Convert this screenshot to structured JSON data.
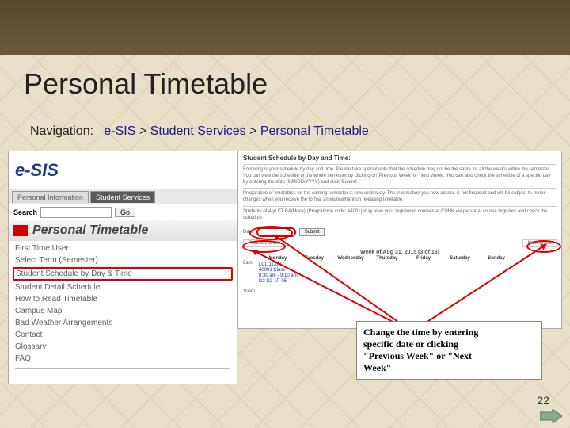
{
  "title": "Personal Timetable",
  "nav": {
    "label": "Navigation:",
    "p1": "e-SIS",
    "sep1": " > ",
    "p2": "Student Services",
    "sep2": " > ",
    "p3": "Personal Timetable"
  },
  "logo": "e-SIS",
  "tabs": {
    "t1": "Personal Information",
    "t2": "Student Services"
  },
  "search": {
    "label": "Search",
    "placeholder": "",
    "go": "Go"
  },
  "ptheader": "Personal Timetable",
  "menu": [
    "First Time User",
    "Select Term (Semester)",
    "Student Schedule by Day & Time",
    "Student Detail Schedule",
    "How to Read Timetable",
    "Campus Map",
    "Bad Weather Arrangements",
    "Contact",
    "Glossary",
    "FAQ"
  ],
  "right": {
    "title": "Student Schedule by Day and Time:",
    "note1": "Following is your schedule by day and time. Please take special note that the schedule may not be the same for all the weeks within the semester. You can view the schedule of the whole semester by clicking on 'Previous Week' or 'Next Week'. You can also check the schedule of a specific day by entering the date (MM/DD/YYYY) and click 'Submit'.",
    "note2": "Preparation of timetables for the coming semester is now underway. The information you now access is not finalised and will be subject to minor changes when you receive the formal announcement on releasing timetable.",
    "note3": "Students of 4-yr FT BA(Hons) (Programme code: 44001) may view your registered courses at CUHK via personal course registers and check the schedule.",
    "submit": "Submit",
    "prev": "Previous Week",
    "next": "Next Week",
    "week": "Week of Aug 31, 2015 (3 of 16)",
    "days": [
      "Monday",
      "Tuesday",
      "Wednesday",
      "Thursday",
      "Friday",
      "Saturday",
      "Sunday"
    ],
    "h1": "8am",
    "h2": "10am",
    "cell": [
      "LCL 1139 C",
      "40001 Class",
      "8:30 am - 9:10 am",
      "D2 D2-1P-05"
    ]
  },
  "callout": {
    "l1": "Change the time by entering",
    "l2": "specific date or clicking",
    "l3": "\"Previous Week\" or \"Next",
    "l4": "Week\""
  },
  "page": "22"
}
